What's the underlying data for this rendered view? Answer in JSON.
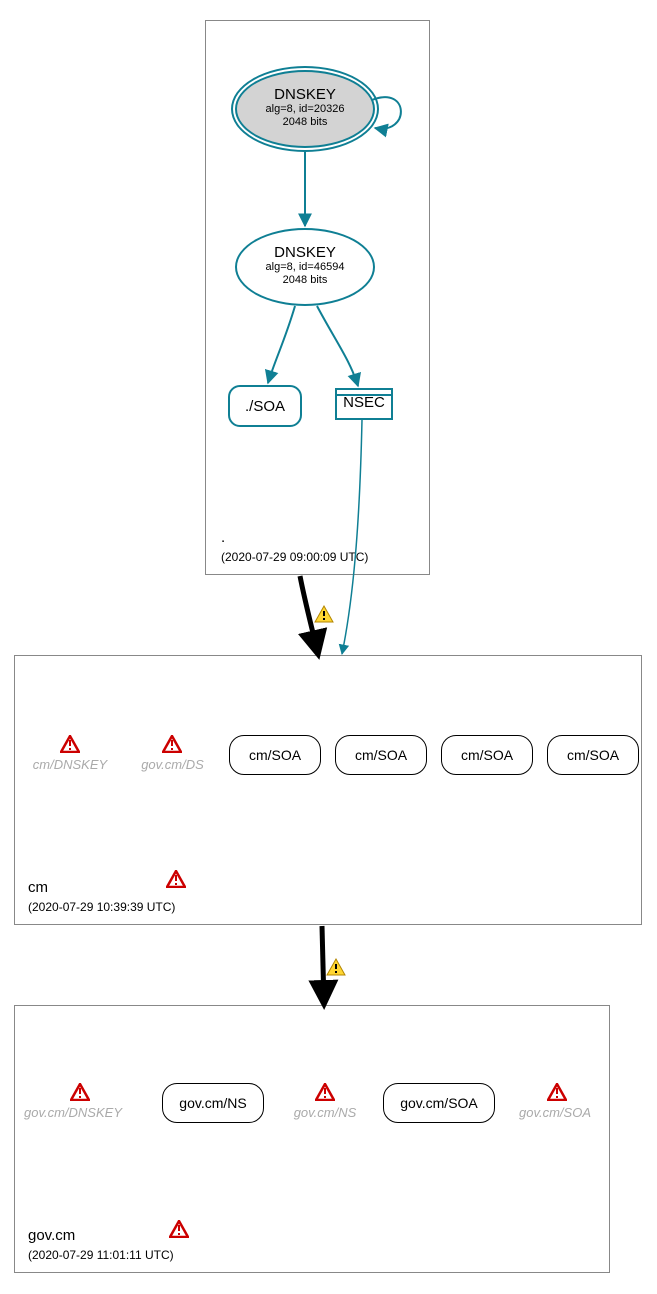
{
  "zones": {
    "root": {
      "label": ".",
      "ts": "(2020-07-29 09:00:09 UTC)"
    },
    "cm": {
      "label": "cm",
      "ts": "(2020-07-29 10:39:39 UTC)"
    },
    "gov": {
      "label": "gov.cm",
      "ts": "(2020-07-29 11:01:11 UTC)"
    }
  },
  "root_nodes": {
    "ksk": {
      "title": "DNSKEY",
      "alg": "alg=8, id=20326",
      "bits": "2048 bits"
    },
    "zsk": {
      "title": "DNSKEY",
      "alg": "alg=8, id=46594",
      "bits": "2048 bits"
    },
    "soa": "./SOA",
    "nsec": "NSEC"
  },
  "cm_nodes": {
    "dnskey_bogus": "cm/DNSKEY",
    "ds_bogus": "gov.cm/DS",
    "soa1": "cm/SOA",
    "soa2": "cm/SOA",
    "soa3": "cm/SOA",
    "soa4": "cm/SOA"
  },
  "gov_nodes": {
    "dnskey_bogus": "gov.cm/DNSKEY",
    "ns": "gov.cm/NS",
    "ns_bogus": "gov.cm/NS",
    "soa": "gov.cm/SOA",
    "soa_bogus": "gov.cm/SOA"
  }
}
